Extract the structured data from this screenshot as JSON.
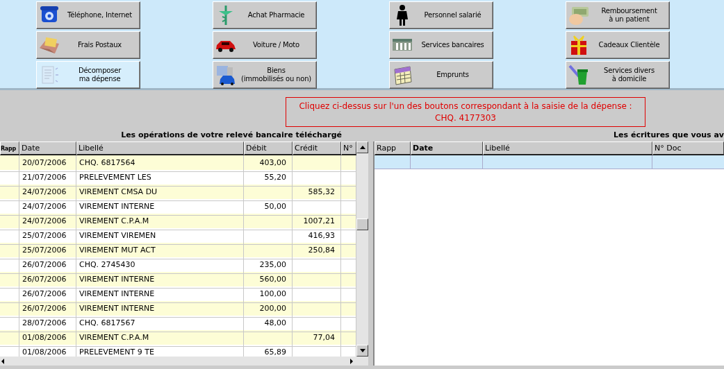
{
  "buttons": [
    {
      "label": "Téléphone, Internet",
      "highlighted": false
    },
    {
      "label": "Achat Pharmacie",
      "highlighted": false
    },
    {
      "label": "Personnel salarié",
      "highlighted": false
    },
    {
      "label": "Remboursement\nà un patient",
      "highlighted": false
    },
    {
      "label": "Frais Postaux",
      "highlighted": false
    },
    {
      "label": "Voiture / Moto",
      "highlighted": false
    },
    {
      "label": "Services bancaires",
      "highlighted": false
    },
    {
      "label": "Cadeaux Clientèle",
      "highlighted": false
    },
    {
      "label": "Décomposer\nma dépense",
      "highlighted": true
    },
    {
      "label": "Biens\n(immobilisés ou non)",
      "highlighted": false
    },
    {
      "label": "Emprunts",
      "highlighted": false
    },
    {
      "label": "Services divers\nà domicile",
      "highlighted": false
    }
  ],
  "message": {
    "line_1": "Cliquez ci-dessus sur l'un des boutons correspondant à la saisie de la dépense :",
    "line_2": "CHQ. 4177303"
  },
  "bank_table": {
    "title": "Les opérations de votre relevé bancaire téléchargé",
    "columns": [
      "Rapp",
      "Date",
      "Libellé",
      "Débit",
      "Crédit",
      "N°"
    ],
    "rows": [
      {
        "date": "20/07/2006",
        "label": "CHQ. 6817564",
        "debit": "403,00"
      },
      {
        "date": "21/07/2006",
        "label": "PRELEVEMENT LES",
        "debit": "55,20"
      },
      {
        "date": "24/07/2006",
        "label": "VIREMENT CMSA DU",
        "credit": "585,32"
      },
      {
        "date": "24/07/2006",
        "label": "VIREMENT INTERNE",
        "debit": "50,00"
      },
      {
        "date": "24/07/2006",
        "label": "VIREMENT C.P.A.M",
        "credit": "1007,21"
      },
      {
        "date": "25/07/2006",
        "label": "VIREMENT VIREMEN",
        "credit": "416,93"
      },
      {
        "date": "25/07/2006",
        "label": "VIREMENT MUT ACT",
        "credit": "250,84"
      },
      {
        "date": "26/07/2006",
        "label": "CHQ. 2745430",
        "debit": "235,00"
      },
      {
        "date": "26/07/2006",
        "label": "VIREMENT INTERNE",
        "debit": "560,00"
      },
      {
        "date": "26/07/2006",
        "label": "VIREMENT INTERNE",
        "debit": "100,00"
      },
      {
        "date": "26/07/2006",
        "label": "VIREMENT INTERNE",
        "debit": "200,00"
      },
      {
        "date": "28/07/2006",
        "label": "CHQ. 6817567",
        "debit": "48,00"
      },
      {
        "date": "01/08/2006",
        "label": "VIREMENT C.P.A.M",
        "credit": "77,04"
      },
      {
        "date": "01/08/2006",
        "label": "PRELEVEMENT 9 TE",
        "debit": "65,89"
      }
    ]
  },
  "entries_table": {
    "title": "Les écritures que vous av",
    "columns": [
      "Rapp",
      "Date",
      "Libellé",
      "N° Doc"
    ]
  }
}
